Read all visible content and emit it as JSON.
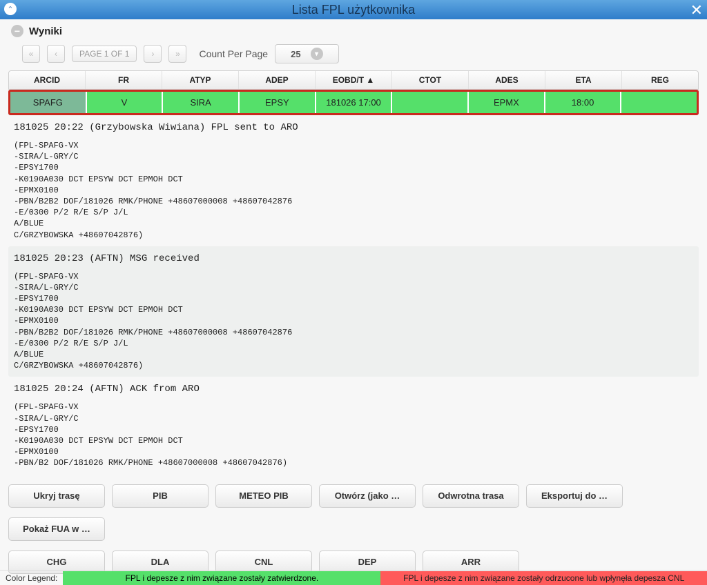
{
  "title": "Lista FPL użytkownika",
  "section_label": "Wyniki",
  "pager": {
    "text": "PAGE 1 OF 1",
    "first": "«",
    "prev": "‹",
    "next": "›",
    "last": "»"
  },
  "count_per_page": {
    "label": "Count Per Page",
    "value": "25"
  },
  "columns": {
    "arcid": "ARCID",
    "fr": "FR",
    "atyp": "ATYP",
    "adep": "ADEP",
    "eobd": "EOBD/T ▲",
    "ctot": "CTOT",
    "ades": "ADES",
    "eta": "ETA",
    "reg": "REG"
  },
  "row": {
    "arcid": "SPAFG",
    "fr": "V",
    "atyp": "SIRA",
    "adep": "EPSY",
    "eobd": "181026 17:00",
    "ctot": "",
    "ades": "EPMX",
    "eta": "18:00",
    "reg": ""
  },
  "messages": [
    {
      "header": "181025 20:22 (Grzybowska Wiwiana) FPL sent to ARO",
      "body": "(FPL-SPAFG-VX\n-SIRA/L-GRY/C\n-EPSY1700\n-K0190A030 DCT EPSYW DCT EPMOH DCT\n-EPMX0100\n-PBN/B2B2 DOF/181026 RMK/PHONE +48607000008 +48607042876\n-E/0300 P/2 R/E S/P J/L\nA/BLUE\nC/GRZYBOWSKA +48607042876)",
      "gray": false
    },
    {
      "header": "181025 20:23 (AFTN) MSG received",
      "body": "(FPL-SPAFG-VX\n-SIRA/L-GRY/C\n-EPSY1700\n-K0190A030 DCT EPSYW DCT EPMOH DCT\n-EPMX0100\n-PBN/B2B2 DOF/181026 RMK/PHONE +48607000008 +48607042876\n-E/0300 P/2 R/E S/P J/L\nA/BLUE\nC/GRZYBOWSKA +48607042876)",
      "gray": true
    },
    {
      "header": "181025 20:24 (AFTN) ACK from ARO",
      "body": "(FPL-SPAFG-VX\n-SIRA/L-GRY/C\n-EPSY1700\n-K0190A030 DCT EPSYW DCT EPMOH DCT\n-EPMX0100\n-PBN/B2 DOF/181026 RMK/PHONE +48607000008 +48607042876)",
      "gray": false
    }
  ],
  "buttons_row1": [
    "Ukryj trasę",
    "PIB",
    "METEO PIB",
    "Otwórz (jako …",
    "Odwrotna trasa",
    "Eksportuj do …"
  ],
  "buttons_row2": [
    "Pokaż FUA w …"
  ],
  "buttons_row3": [
    "CHG",
    "DLA",
    "CNL",
    "DEP",
    "ARR"
  ],
  "legend": {
    "label": "Color Legend:",
    "green": "FPL i depesze z nim związane zostały zatwierdzone.",
    "red": "FPL i depesze z nim związane zostały odrzucone lub wpłynęła depesza CNL"
  }
}
